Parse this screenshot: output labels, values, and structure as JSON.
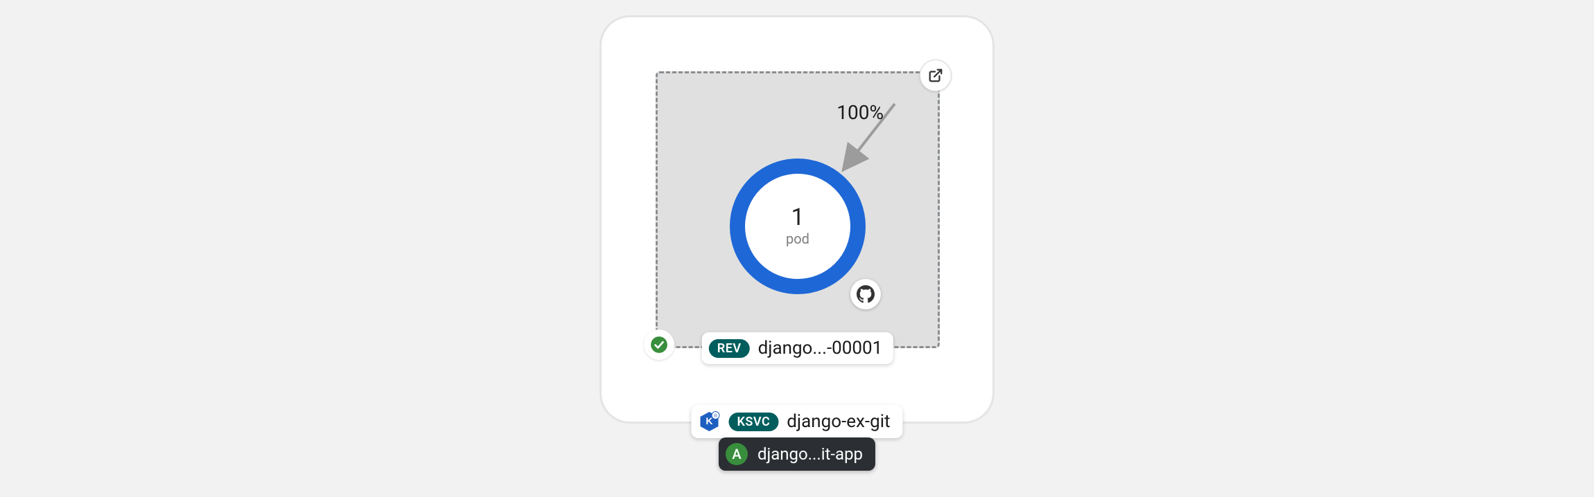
{
  "traffic": {
    "percent_label": "100%"
  },
  "pod": {
    "count": "1",
    "label": "pod"
  },
  "revision": {
    "badge": "REV",
    "name": "django...-00001"
  },
  "service": {
    "badge": "KSVC",
    "name": "django-ex-git"
  },
  "application": {
    "badge": "A",
    "name": "django...it-app"
  },
  "colors": {
    "ring": "#1e67d6",
    "badge_teal": "#005D5D",
    "app_badge": "#388e3c",
    "app_bg": "#2b2e33",
    "check": "#388e3c"
  }
}
